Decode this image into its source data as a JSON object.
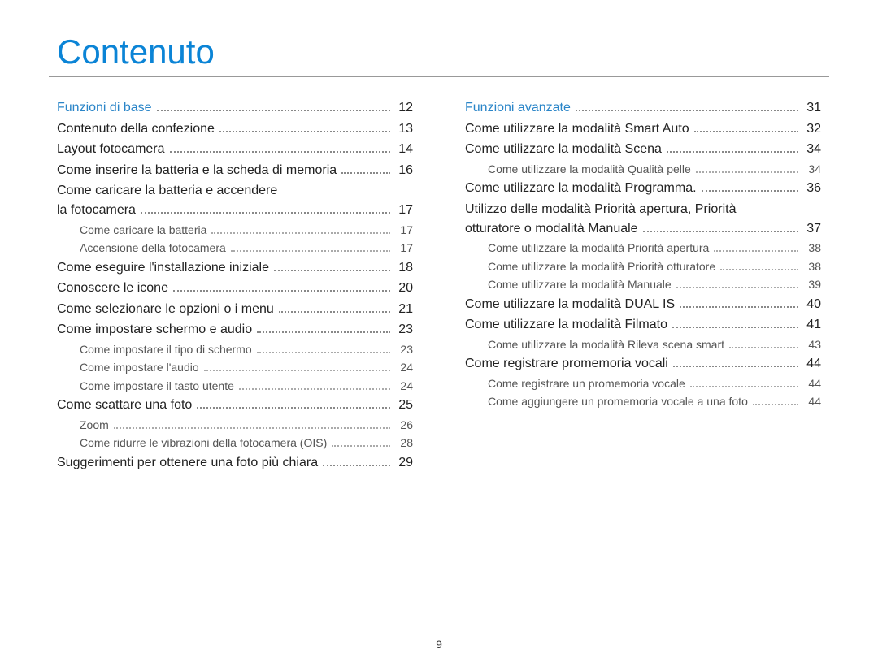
{
  "title": "Contenuto",
  "page_number": "9",
  "left": {
    "section": {
      "label": "Funzioni di base",
      "page": "12"
    },
    "items": [
      {
        "type": "item",
        "label": "Contenuto della confezione",
        "page": "13"
      },
      {
        "type": "item",
        "label": "Layout fotocamera",
        "page": "14"
      },
      {
        "type": "item",
        "label": "Come inserire la batteria e la scheda di memoria",
        "page": "16"
      },
      {
        "type": "itemwrap",
        "line1": "Come caricare la batteria e accendere",
        "line2": "la fotocamera",
        "page": "17"
      },
      {
        "type": "sub",
        "label": "Come caricare la batteria",
        "page": "17"
      },
      {
        "type": "sub",
        "label": "Accensione della fotocamera",
        "page": "17"
      },
      {
        "type": "item",
        "label": "Come eseguire l'installazione iniziale",
        "page": "18"
      },
      {
        "type": "item",
        "label": "Conoscere le icone",
        "page": "20"
      },
      {
        "type": "item",
        "label": "Come selezionare le opzioni o i menu",
        "page": "21"
      },
      {
        "type": "item",
        "label": "Come impostare schermo e audio",
        "page": "23"
      },
      {
        "type": "sub",
        "label": "Come impostare il tipo di schermo",
        "page": "23"
      },
      {
        "type": "sub",
        "label": "Come impostare l'audio",
        "page": "24"
      },
      {
        "type": "sub",
        "label": "Come impostare il tasto utente",
        "page": "24"
      },
      {
        "type": "item",
        "label": "Come scattare una foto",
        "page": "25"
      },
      {
        "type": "sub",
        "label": "Zoom",
        "page": "26"
      },
      {
        "type": "sub",
        "label": "Come ridurre le vibrazioni della fotocamera (OIS)",
        "page": "28"
      },
      {
        "type": "item",
        "label": "Suggerimenti per ottenere una foto più chiara",
        "page": "29"
      }
    ]
  },
  "right": {
    "section": {
      "label": "Funzioni avanzate",
      "page": "31"
    },
    "items": [
      {
        "type": "item",
        "label": "Come utilizzare la modalità Smart Auto",
        "page": "32"
      },
      {
        "type": "item",
        "label": "Come utilizzare la modalità Scena",
        "page": "34"
      },
      {
        "type": "sub",
        "label": "Come utilizzare la modalità Qualità pelle",
        "page": "34"
      },
      {
        "type": "item",
        "label": "Come utilizzare la modalità Programma.",
        "page": "36"
      },
      {
        "type": "itemwrap",
        "line1": "Utilizzo delle modalità Priorità apertura, Priorità",
        "line2": "otturatore o modalità Manuale",
        "page": "37"
      },
      {
        "type": "sub",
        "label": "Come utilizzare la modalità Priorità apertura",
        "page": "38"
      },
      {
        "type": "sub",
        "label": "Come utilizzare la modalità Priorità otturatore",
        "page": "38"
      },
      {
        "type": "sub",
        "label": "Come utilizzare la modalità Manuale",
        "page": "39"
      },
      {
        "type": "item",
        "label": "Come utilizzare la modalità DUAL IS",
        "page": "40"
      },
      {
        "type": "item",
        "label": "Come utilizzare la modalità Filmato",
        "page": "41"
      },
      {
        "type": "sub",
        "label": "Come utilizzare la modalità Rileva scena smart",
        "page": "43"
      },
      {
        "type": "item",
        "label": "Come registrare promemoria vocali",
        "page": "44"
      },
      {
        "type": "sub",
        "label": "Come registrare un promemoria vocale",
        "page": "44"
      },
      {
        "type": "sub",
        "label": "Come aggiungere un promemoria vocale a una foto",
        "page": "44"
      }
    ]
  }
}
